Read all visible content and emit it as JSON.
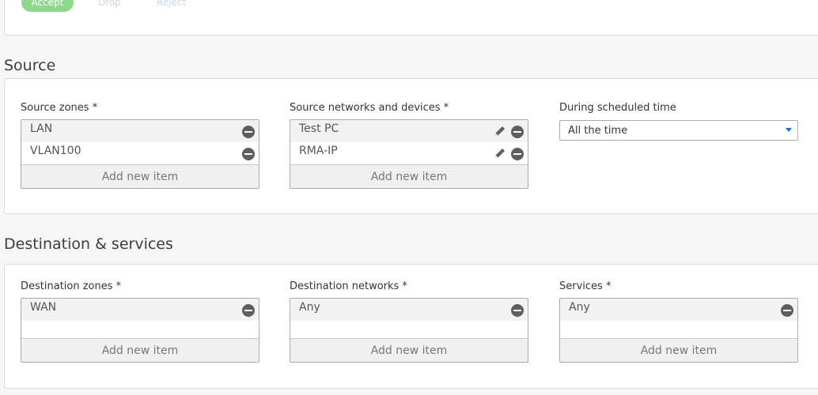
{
  "action": {
    "accept": "Accept",
    "drop": "Drop",
    "reject": "Reject"
  },
  "source": {
    "title": "Source",
    "zones": {
      "label": "Source zones *",
      "items": [
        "LAN",
        "VLAN100"
      ],
      "add": "Add new item"
    },
    "networks": {
      "label": "Source networks and devices *",
      "items": [
        "Test PC",
        "RMA-IP"
      ],
      "add": "Add new item"
    },
    "schedule": {
      "label": "During scheduled time",
      "value": "All the time"
    }
  },
  "destination": {
    "title": "Destination & services",
    "zones": {
      "label": "Destination zones *",
      "items": [
        "WAN"
      ],
      "add": "Add new item"
    },
    "networks": {
      "label": "Destination networks *",
      "items": [
        "Any"
      ],
      "add": "Add new item"
    },
    "services": {
      "label": "Services *",
      "items": [
        "Any"
      ],
      "add": "Add new item"
    }
  },
  "icons": {
    "remove": "remove-icon",
    "edit": "pencil-icon",
    "dropdown": "chevron-down-icon"
  },
  "colors": {
    "accept": "#8fd88f",
    "dropdown_caret": "#1a73c8",
    "icon": "#5e5e5e"
  }
}
